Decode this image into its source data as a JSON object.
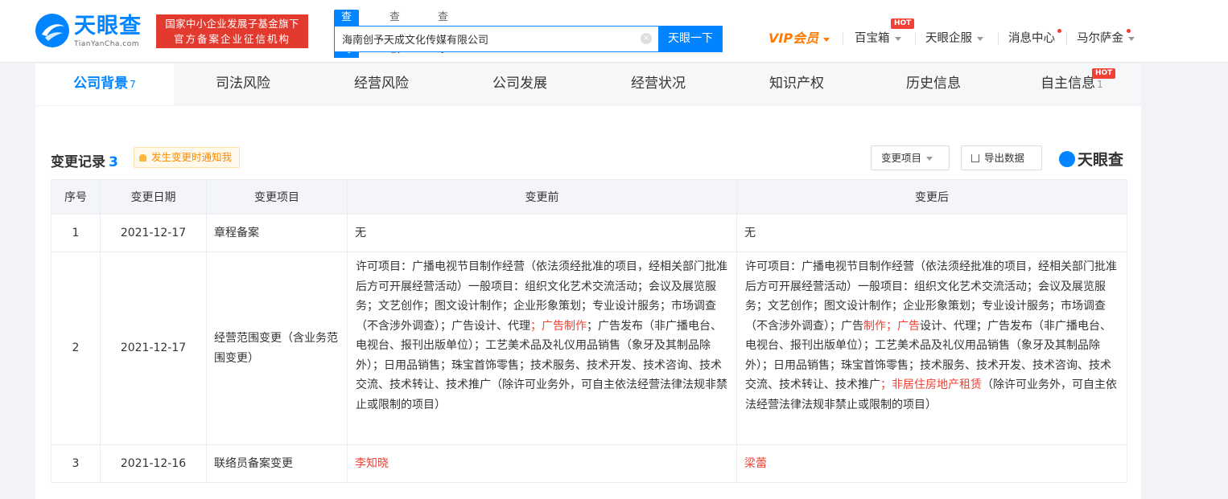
{
  "header": {
    "logo_name": "天眼查",
    "logo_sub": "TianYanCha.com",
    "badge_line1": "国家中小企业发展子基金旗下",
    "badge_line2": "官方备案企业征信机构",
    "search_tabs": [
      "查公司",
      "查老板",
      "查关系"
    ],
    "search_value": "海南创予天成文化传媒有限公司",
    "search_button": "天眼一下",
    "nav": {
      "vip": "VIP会员",
      "treasure": "百宝箱",
      "hot": "HOT",
      "enterprise": "天眼企服",
      "messages": "消息中心",
      "user": "马尔萨金"
    }
  },
  "tabs": [
    {
      "label": "公司背景",
      "count": "7"
    },
    {
      "label": "司法风险"
    },
    {
      "label": "经营风险"
    },
    {
      "label": "公司发展"
    },
    {
      "label": "经营状况"
    },
    {
      "label": "知识产权"
    },
    {
      "label": "历史信息"
    },
    {
      "label": "自主信息",
      "count": "1",
      "hot": "HOT"
    }
  ],
  "section": {
    "title": "变更记录",
    "count": "3",
    "notify": "发生变更时通知我",
    "filter_button": "变更项目",
    "export_button": "导出数据",
    "watermark": "天眼查"
  },
  "table": {
    "headers": [
      "序号",
      "变更日期",
      "变更项目",
      "变更前",
      "变更后"
    ],
    "rows": [
      {
        "no": "1",
        "date": "2021-12-17",
        "item": "章程备案",
        "before": "无",
        "after": "无"
      },
      {
        "no": "2",
        "date": "2021-12-17",
        "item": "经营范围变更（含业务范围变更）",
        "before_a": "许可项目：广播电视节目制作经营（依法须经批准的项目，经相关部门批准后方可开展经营活动）一般项目：组织文化艺术交流活动；会议及展览服务；文艺创作；图文设计制作；企业形象策划；专业设计服务；市场调查（不含涉外调查）；广告设计、代理",
        "before_hl": "；广告制作",
        "before_b": "；广告发布（非广播电台、电视台、报刊出版单位）；工艺美术品及礼仪用品销售（象牙及其制品除外）；日用品销售；珠宝首饰零售；技术服务、技术开发、技术咨询、技术交流、技术转让、技术推广（除许可业务外，可自主依法经营法律法规非禁止或限制的项目）",
        "after_a": "许可项目：广播电视节目制作经营（依法须经批准的项目，经相关部门批准后方可开展经营活动）一般项目：组织文化艺术交流活动；会议及展览服务；文艺创作；图文设计制作；企业形象策划；专业设计服务；市场调查（不含涉外调查）；广告",
        "after_hl1": "制作；广告",
        "after_b": "设计、代理；广告发布（非广播电台、电视台、报刊出版单位）；工艺美术品及礼仪用品销售（象牙及其制品除外）；日用品销售；珠宝首饰零售；技术服务、技术开发、技术咨询、技术交流、技术转让、技术推广",
        "after_hl2": "；非居住房地产租赁",
        "after_c": "（除许可业务外，可自主依法经营法律法规非禁止或限制的项目）"
      },
      {
        "no": "3",
        "date": "2021-12-16",
        "item": "联络员备案变更",
        "before": "李知晓",
        "after": "梁蕾"
      }
    ]
  },
  "colors": {
    "brand": "#0084ff",
    "highlight": "#f04134",
    "vip": "#ff7a00"
  }
}
